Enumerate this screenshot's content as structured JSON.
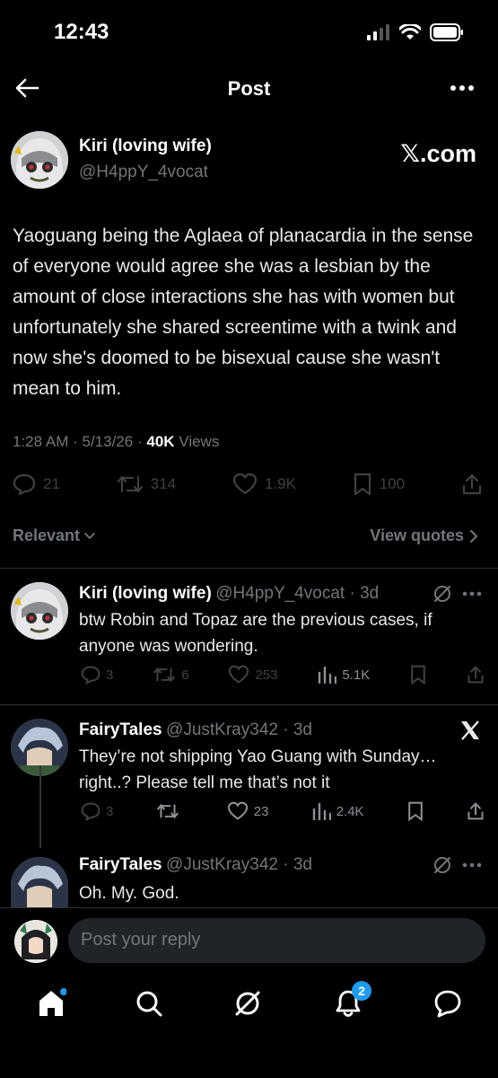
{
  "status_bar": {
    "time": "12:43"
  },
  "header": {
    "title": "Post"
  },
  "post": {
    "author_name": "Kiri (loving wife)",
    "author_handle": "@H4ppY_4vocat",
    "source_badge": "𝕏.com",
    "text": "Yaoguang being the Aglaea of planacardia in the sense of everyone would agree she was a lesbian by the amount of close interactions she has with women but unfortunately she shared screentime with a twink and now she's doomed to be bisexual cause she wasn't mean to him.",
    "time": "1:28 AM",
    "date": "5/13/26",
    "views_count": "40K",
    "views_label": "Views",
    "replies": "21",
    "reposts": "314",
    "likes": "1.9K",
    "bookmarks": "100"
  },
  "sort": {
    "label": "Relevant",
    "view_quotes": "View quotes"
  },
  "replies": [
    {
      "name": "Kiri (loving wife)",
      "handle": "@H4ppY_4vocat",
      "age": "3d",
      "text": "btw Robin and Topaz are the previous cases, if anyone was wondering.",
      "replies": "3",
      "reposts": "6",
      "likes": "253",
      "views": "5.1K"
    },
    {
      "name": "FairyTales",
      "handle": "@JustKray342",
      "age": "3d",
      "text": "They’re not shipping Yao Guang with Sunday… right..? Please tell me that’s not it",
      "replies": "3",
      "reposts": "",
      "likes": "23",
      "views": "2.4K"
    },
    {
      "name": "FairyTales",
      "handle": "@JustKray342",
      "age": "3d",
      "text": "Oh. My. God."
    }
  ],
  "composer": {
    "placeholder": "Post your reply"
  },
  "tab_bar": {
    "notifications_badge": "2"
  },
  "colors": {
    "background": "#000000",
    "text": "#e7e9ea",
    "muted": "#71767b",
    "accent": "#1d9bf0"
  }
}
